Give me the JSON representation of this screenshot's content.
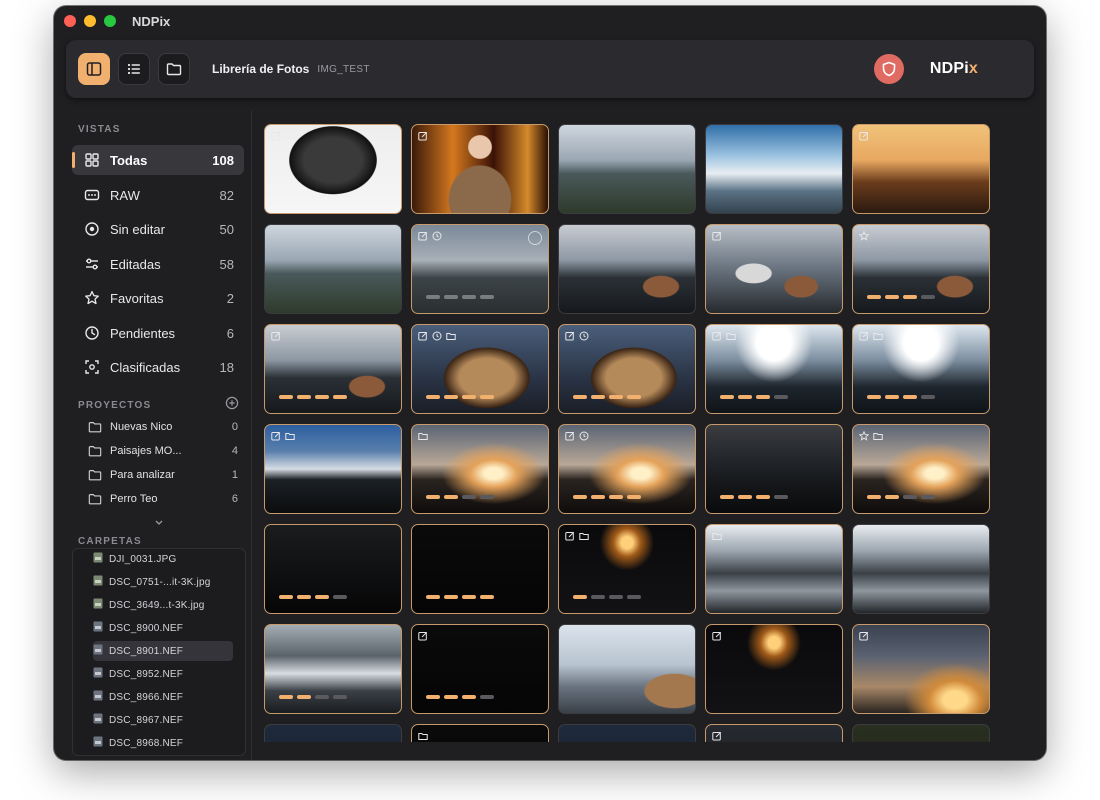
{
  "app": {
    "title": "NDPix"
  },
  "toolbar": {
    "library_title": "Librería de Fotos",
    "library_subtitle": "IMG_TEST",
    "brand": "NDPi",
    "brand_mark": "x"
  },
  "sidebar": {
    "views_header": "VISTAS",
    "views": [
      {
        "label": "Todas",
        "count": "108",
        "icon": "grid-icon"
      },
      {
        "label": "RAW",
        "count": "82",
        "icon": "raw-icon"
      },
      {
        "label": "Sin editar",
        "count": "50",
        "icon": "circle-dot-icon"
      },
      {
        "label": "Editadas",
        "count": "58",
        "icon": "sliders-icon"
      },
      {
        "label": "Favoritas",
        "count": "2",
        "icon": "star-icon"
      },
      {
        "label": "Pendientes",
        "count": "6",
        "icon": "clock-icon"
      },
      {
        "label": "Clasificadas",
        "count": "18",
        "icon": "classify-icon"
      }
    ],
    "projects_header": "PROYECTOS",
    "projects": [
      {
        "label": "Nuevas Nico",
        "count": "0"
      },
      {
        "label": "Paisajes MO...",
        "count": "4"
      },
      {
        "label": "Para analizar",
        "count": "1"
      },
      {
        "label": "Perro Teo",
        "count": "6"
      }
    ],
    "folders_header": "CARPETAS",
    "files": [
      "DJI_0031.JPG",
      "DSC_0751-...it-3K.jpg",
      "DSC_3649...t-3K.jpg",
      "DSC_8900.NEF",
      "DSC_8901.NEF",
      "DSC_8952.NEF",
      "DSC_8966.NEF",
      "DSC_8967.NEF",
      "DSC_8968.NEF"
    ]
  },
  "thumbnails": [
    {
      "scene": "lens",
      "badges": [
        "edit"
      ],
      "rating": null
    },
    {
      "scene": "portrait",
      "badges": [
        "edit"
      ],
      "rating": null
    },
    {
      "scene": "coast-day",
      "badges": [],
      "rating": null
    },
    {
      "scene": "sky-blue",
      "badges": [],
      "rating": null
    },
    {
      "scene": "sunset-gold",
      "badges": [
        "edit"
      ],
      "rating": null
    },
    {
      "scene": "coast-day",
      "badges": [],
      "rating": null
    },
    {
      "scene": "coast-dusk",
      "badges": [
        "edit",
        "clock"
      ],
      "rating": 0
    },
    {
      "scene": "coast-dog",
      "badges": [],
      "rating": null
    },
    {
      "scene": "coast-dog-light",
      "badges": [
        "edit"
      ],
      "rating": null
    },
    {
      "scene": "coast-dog",
      "badges": [
        "star"
      ],
      "rating": 3
    },
    {
      "scene": "coast-dog",
      "badges": [
        "edit"
      ],
      "rating": 5
    },
    {
      "scene": "dog-close",
      "badges": [
        "edit",
        "clock",
        "folder"
      ],
      "rating": 5
    },
    {
      "scene": "dog-close",
      "badges": [
        "edit",
        "clock"
      ],
      "rating": 4
    },
    {
      "scene": "coast-bright",
      "badges": [
        "edit",
        "folder"
      ],
      "rating": 3
    },
    {
      "scene": "coast-bright",
      "badges": [
        "edit",
        "folder"
      ],
      "rating": 3
    },
    {
      "scene": "sky-blue-dark",
      "badges": [
        "edit",
        "folder"
      ],
      "rating": null
    },
    {
      "scene": "sunset-rocks",
      "badges": [
        "folder"
      ],
      "rating": 2
    },
    {
      "scene": "sunset-rocks",
      "badges": [
        "edit",
        "clock"
      ],
      "rating": 5
    },
    {
      "scene": "rocks-dark",
      "badges": [],
      "rating": 3
    },
    {
      "scene": "sunset-rocks",
      "badges": [
        "star",
        "folder"
      ],
      "rating": 2
    },
    {
      "scene": "night-rocks",
      "badges": [],
      "rating": 3
    },
    {
      "scene": "black",
      "badges": [],
      "rating": 4
    },
    {
      "scene": "night-sun",
      "badges": [
        "edit",
        "folder"
      ],
      "rating": 1
    },
    {
      "scene": "waves",
      "badges": [
        "folder"
      ],
      "rating": null
    },
    {
      "scene": "waves",
      "badges": [],
      "rating": null
    },
    {
      "scene": "waves-close",
      "badges": [],
      "rating": 2
    },
    {
      "scene": "black",
      "badges": [
        "edit"
      ],
      "rating": 3
    },
    {
      "scene": "rocks-bright",
      "badges": [],
      "rating": null
    },
    {
      "scene": "night-sun",
      "badges": [
        "edit"
      ],
      "rating": null
    },
    {
      "scene": "clouds-sunset",
      "badges": [
        "edit"
      ],
      "rating": null
    },
    {
      "scene": "night-blue",
      "badges": [],
      "rating": null
    },
    {
      "scene": "black",
      "badges": [
        "folder"
      ],
      "rating": null
    },
    {
      "scene": "night-blue",
      "badges": [],
      "rating": null
    },
    {
      "scene": "night-sky",
      "badges": [
        "edit"
      ],
      "rating": null
    },
    {
      "scene": "night-tree",
      "badges": [],
      "rating": null
    }
  ],
  "colors": {
    "accent": "#f2b06f",
    "shield": "#e06b63",
    "window_bg": "#1f1f22"
  }
}
